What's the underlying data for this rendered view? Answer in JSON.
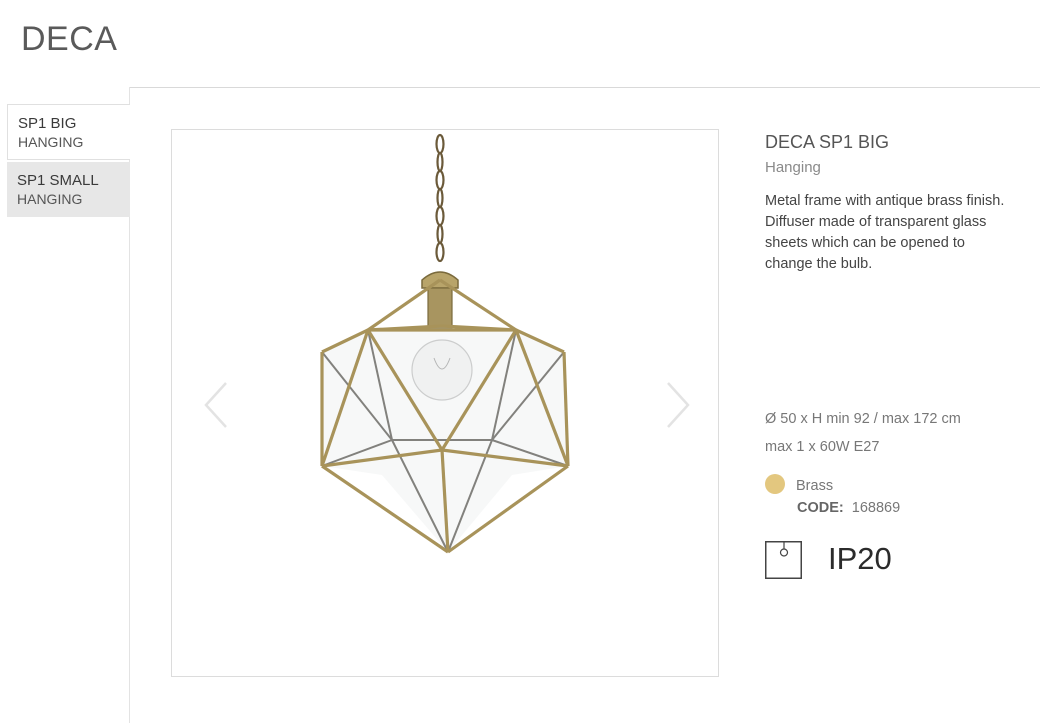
{
  "page": {
    "title": "DECA"
  },
  "tabs": [
    {
      "name": "SP1 BIG",
      "type": "HANGING",
      "active": true
    },
    {
      "name": "SP1 SMALL",
      "type": "HANGING",
      "active": false
    }
  ],
  "gallery": {
    "prev_icon": "chevron-left-icon",
    "next_icon": "chevron-right-icon",
    "image": "pendant-lamp-photo"
  },
  "product": {
    "title": "DECA SP1 BIG",
    "subtitle": "Hanging",
    "description": "Metal frame with antique brass finish. Diffuser made of transparent glass sheets which can be opened to change the bulb.",
    "dimensions": "Ø 50 x H min 92 / max 172 cm",
    "bulb": "max 1 x 60W E27",
    "finish": {
      "name": "Brass",
      "color": "#e3c77f"
    },
    "code_label": "CODE:",
    "code": "168869",
    "ip_icon": "ceiling-lamp-icon",
    "ip_rating": "IP20"
  }
}
